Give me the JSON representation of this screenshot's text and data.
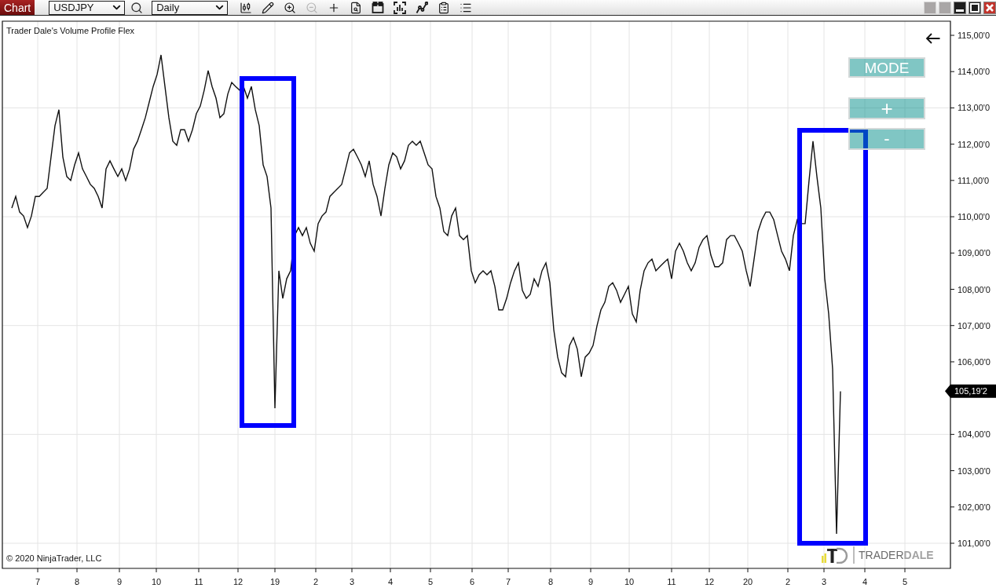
{
  "toolbar": {
    "tab": "Chart",
    "instrument": {
      "value": "USDJPY"
    },
    "timeframe": {
      "value": "Daily"
    },
    "tools": [
      {
        "disabled": false
      },
      {
        "disabled": false
      },
      {
        "disabled": false
      },
      {
        "disabled": true
      },
      {
        "disabled": false
      },
      {
        "disabled": false
      },
      {
        "disabled": false
      },
      {
        "disabled": false
      },
      {
        "disabled": false
      },
      {
        "disabled": false
      },
      {
        "disabled": false
      }
    ]
  },
  "chart": {
    "indicator_label": "Trader Dale's Volume Profile Flex",
    "buttons": [
      "MODE",
      "+",
      "-"
    ],
    "price_labels": [
      "115,00'0",
      "114,00'0",
      "113,00'0",
      "112,00'0",
      "111,00'0",
      "110,00'0",
      "109,00'0",
      "108,00'0",
      "107,00'0",
      "106,00'0",
      "104,00'0",
      "103,00'0",
      "102,00'0",
      "101,00'0"
    ],
    "last_price": "105,19'2",
    "copyright": "© 2020 NinjaTrader, LLC",
    "logo": "TRADER**DALE**",
    "date_labels": [
      "7",
      "8",
      "9",
      "10",
      "11",
      "12",
      "19",
      "2",
      "3",
      "4",
      "5",
      "6",
      "7",
      "8",
      "9",
      "10",
      "11",
      "12",
      "20",
      "2",
      "3",
      "4",
      "5"
    ]
  }
}
